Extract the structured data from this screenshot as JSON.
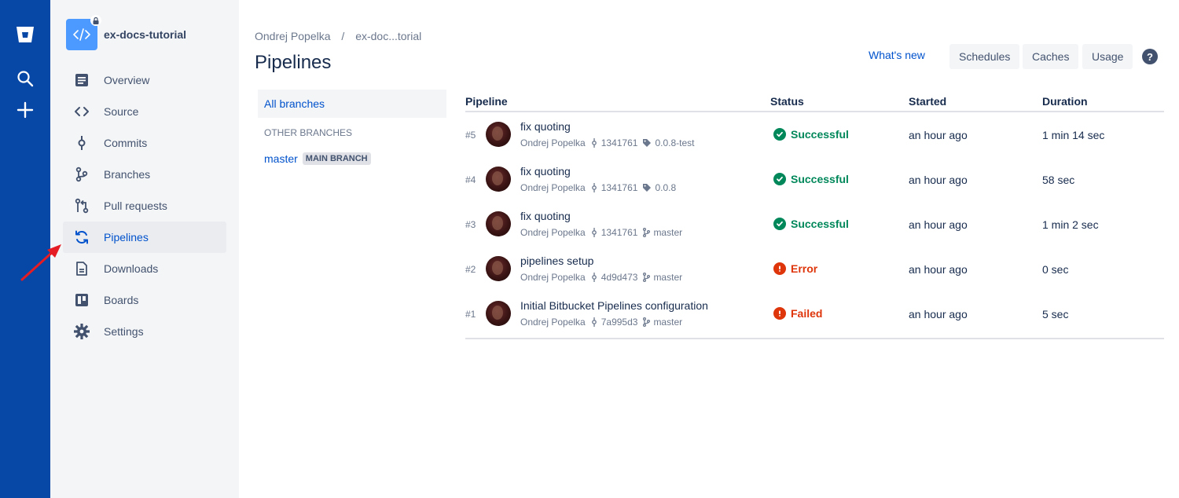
{
  "global_nav": {
    "icons": [
      "bitbucket-logo-icon",
      "search-icon",
      "create-plus-icon"
    ]
  },
  "repo": {
    "name": "ex-docs-tutorial"
  },
  "sidebar": {
    "items": [
      {
        "label": "Overview",
        "icon": "overview-icon"
      },
      {
        "label": "Source",
        "icon": "source-code-icon"
      },
      {
        "label": "Commits",
        "icon": "commits-icon"
      },
      {
        "label": "Branches",
        "icon": "branches-icon"
      },
      {
        "label": "Pull requests",
        "icon": "pull-requests-icon"
      },
      {
        "label": "Pipelines",
        "icon": "pipelines-icon",
        "active": true
      },
      {
        "label": "Downloads",
        "icon": "downloads-icon"
      },
      {
        "label": "Boards",
        "icon": "boards-icon"
      },
      {
        "label": "Settings",
        "icon": "settings-icon"
      }
    ]
  },
  "breadcrumb": {
    "owner": "Ondrej Popelka",
    "separator": "/",
    "repo": "ex-doc...torial"
  },
  "page": {
    "title": "Pipelines"
  },
  "header": {
    "whats_new": "What's new",
    "schedules": "Schedules",
    "caches": "Caches",
    "usage": "Usage",
    "help": "?"
  },
  "branches": {
    "all": "All branches",
    "other_heading": "OTHER BRANCHES",
    "master": "master",
    "main_badge": "MAIN BRANCH"
  },
  "table": {
    "headers": {
      "pipeline": "Pipeline",
      "status": "Status",
      "started": "Started",
      "duration": "Duration"
    },
    "rows": [
      {
        "num": "#5",
        "title": "fix quoting",
        "author": "Ondrej Popelka",
        "commit": "1341761",
        "ref_type": "tag",
        "ref": "0.0.8-test",
        "status": "Successful",
        "status_kind": "success",
        "started": "an hour ago",
        "duration": "1 min 14 sec"
      },
      {
        "num": "#4",
        "title": "fix quoting",
        "author": "Ondrej Popelka",
        "commit": "1341761",
        "ref_type": "tag",
        "ref": "0.0.8",
        "status": "Successful",
        "status_kind": "success",
        "started": "an hour ago",
        "duration": "58 sec"
      },
      {
        "num": "#3",
        "title": "fix quoting",
        "author": "Ondrej Popelka",
        "commit": "1341761",
        "ref_type": "branch",
        "ref": "master",
        "status": "Successful",
        "status_kind": "success",
        "started": "an hour ago",
        "duration": "1 min 2 sec"
      },
      {
        "num": "#2",
        "title": "pipelines setup",
        "author": "Ondrej Popelka",
        "commit": "4d9d473",
        "ref_type": "branch",
        "ref": "master",
        "status": "Error",
        "status_kind": "error",
        "started": "an hour ago",
        "duration": "0 sec"
      },
      {
        "num": "#1",
        "title": "Initial Bitbucket Pipelines configuration",
        "author": "Ondrej Popelka",
        "commit": "7a995d3",
        "ref_type": "branch",
        "ref": "master",
        "status": "Failed",
        "status_kind": "error",
        "started": "an hour ago",
        "duration": "5 sec"
      }
    ]
  },
  "colors": {
    "global_nav": "#0747a6",
    "link": "#0052cc",
    "success": "#00875a",
    "error": "#de350b",
    "sidebar_bg": "#f4f5f7"
  }
}
